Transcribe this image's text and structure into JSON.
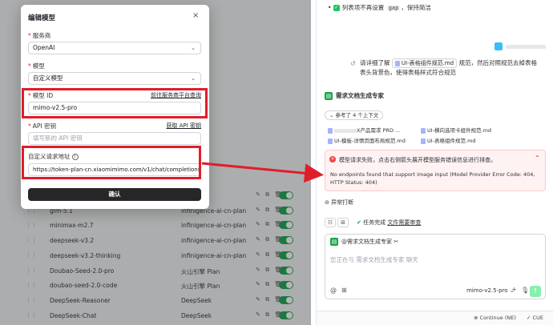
{
  "modal": {
    "title": "编辑模型",
    "close": "×",
    "provider_label": "服务商",
    "provider_value": "OpenAI",
    "model_label": "模型",
    "model_value": "自定义模型",
    "model_id_label": "模型 ID",
    "model_id_link": "前往服务商平台查询",
    "model_id_value": "mimo-v2.5-pro",
    "api_key_label": "API 密钥",
    "api_key_link": "获取 API 密钥",
    "api_key_placeholder": "填写新的 API 密钥",
    "custom_url_label": "自定义请求地址",
    "custom_url_value": "https://token-plan-cn.xiaomimimo.com/v1/chat/completions",
    "confirm_label": "确认",
    "required_mark": "*"
  },
  "model_list": [
    {
      "name": "",
      "provider": "Plan"
    },
    {
      "name": "glm-5.1",
      "provider": "infinigence-ai-cn-plan"
    },
    {
      "name": "minimax-m2.7",
      "provider": "infinigence-ai-cn-plan"
    },
    {
      "name": "deepseek-v3.2",
      "provider": "infinigence-ai-cn-plan"
    },
    {
      "name": "deepseek-v3.2-thinking",
      "provider": "infinigence-ai-cn-plan"
    },
    {
      "name": "Doubao-Seed-2.0-pro",
      "provider": "火山引擎 Plan"
    },
    {
      "name": "doubao-seed-2.0-code",
      "provider": "火山引擎 Plan"
    },
    {
      "name": "DeepSeek-Reasoner",
      "provider": "DeepSeek"
    },
    {
      "name": "DeepSeek-Chat",
      "provider": "DeepSeek"
    }
  ],
  "chat": {
    "top_line_prefix": "列表项不再设置",
    "top_line_code": "gap",
    "top_line_suffix": "，保持简洁",
    "user_msg_1": "请详细了解",
    "user_file_1": "UI-表格组件规范.md",
    "user_msg_2": "规范，然后对照规范去掉表格表头背景色，使得表格样式符合规范",
    "agent_name": "需求文档生成专家",
    "ref_pill": "参考了 4 个上下文",
    "ref_files": [
      "X产品需求 PRD ...",
      "UI-横向选项卡组件规范.md",
      "UI-模板-详情页面布局规范.md",
      "UI-表格组件规范.md"
    ],
    "error_title": "模型请求失败，点击右侧箭头展开模型服务错误信息进行排查。",
    "error_body": "No endpoints found that support image input (Model Provider Error Code: 404, HTTP Status: 404)",
    "abort_label": "异常打断",
    "task_done": "任务完成",
    "file_review": "文件需要审查",
    "composer_mention": "@需求文档生成专家",
    "composer_placeholder": "您正在与 需求文档生成专家 聊天",
    "model_select": "mimo-v2.5-pro",
    "bottom_continue": "Continue (NE)",
    "bottom_cue": "CUE"
  },
  "colors": {
    "accent_red": "#e11d2a",
    "success_green": "#16a34a",
    "error_bg": "#fef2f2"
  }
}
